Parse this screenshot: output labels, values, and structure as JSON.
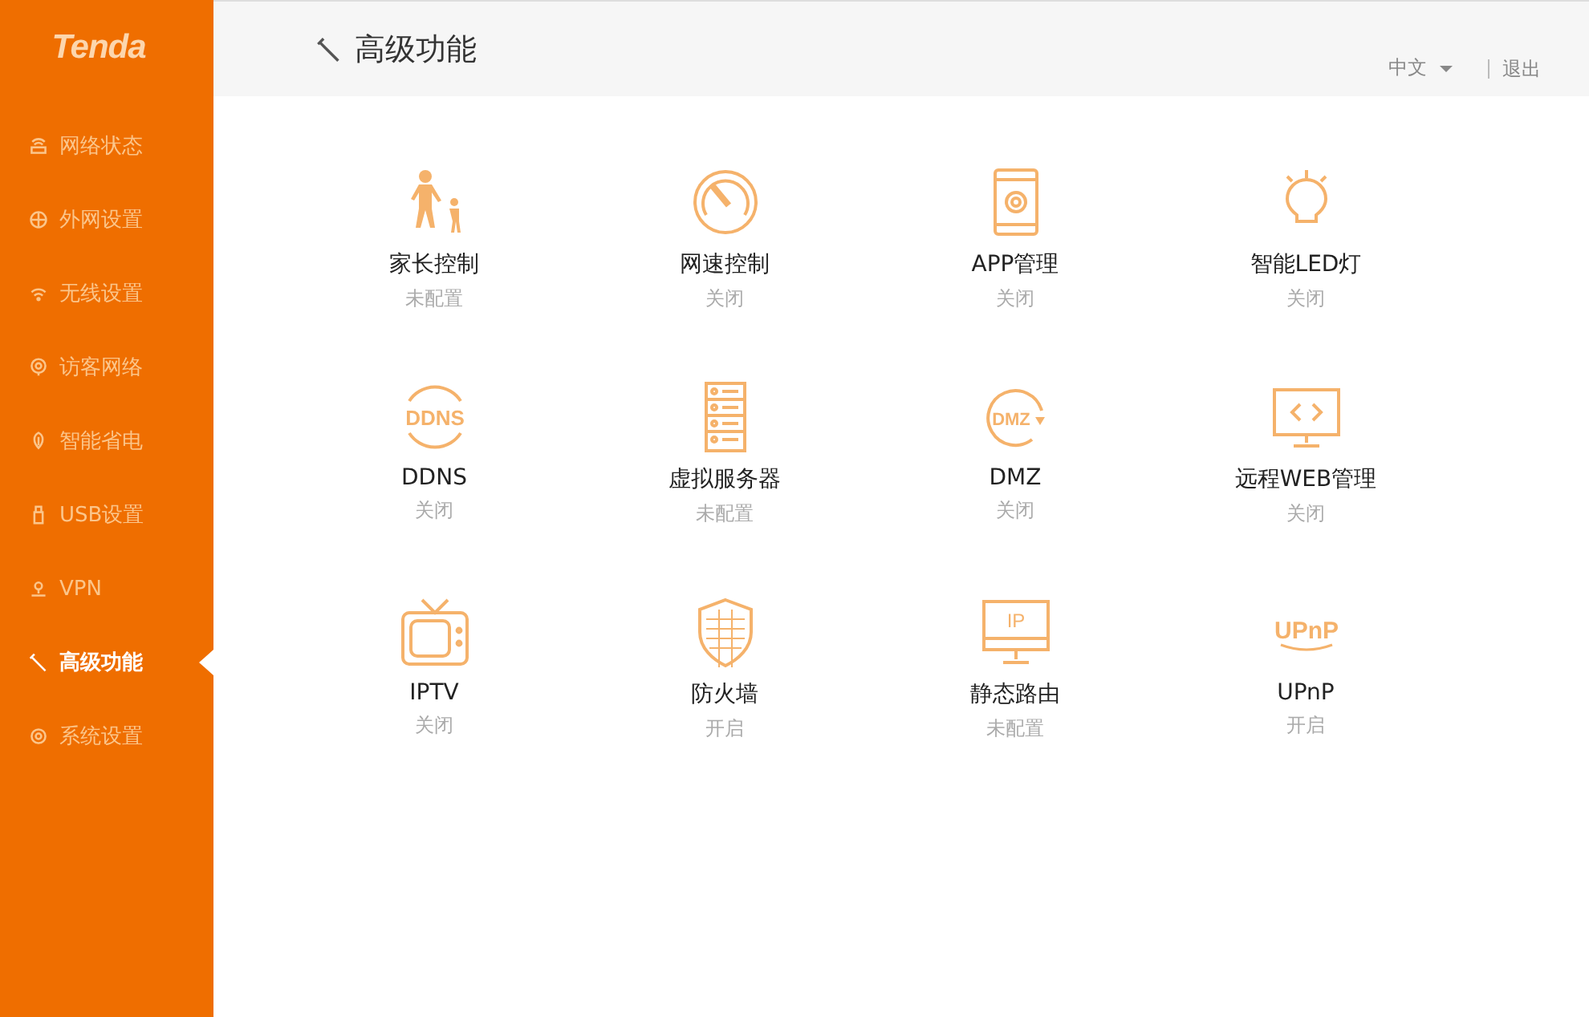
{
  "logo": "Tenda",
  "sidebar": {
    "items": [
      {
        "label": "网络状态",
        "selected": false
      },
      {
        "label": "外网设置",
        "selected": false
      },
      {
        "label": "无线设置",
        "selected": false
      },
      {
        "label": "访客网络",
        "selected": false
      },
      {
        "label": "智能省电",
        "selected": false
      },
      {
        "label": "USB设置",
        "selected": false
      },
      {
        "label": "VPN",
        "selected": false
      },
      {
        "label": "高级功能",
        "selected": true
      },
      {
        "label": "系统设置",
        "selected": false
      }
    ]
  },
  "header": {
    "title": "高级功能",
    "language": "中文",
    "logout": "退出"
  },
  "features": [
    {
      "name": "家长控制",
      "status": "未配置",
      "kind": "parent"
    },
    {
      "name": "网速控制",
      "status": "关闭",
      "kind": "speed"
    },
    {
      "name": "APP管理",
      "status": "关闭",
      "kind": "app"
    },
    {
      "name": "智能LED灯",
      "status": "关闭",
      "kind": "led"
    },
    {
      "name": "DDNS",
      "status": "关闭",
      "kind": "ddns",
      "icon_text": "DDNS"
    },
    {
      "name": "虚拟服务器",
      "status": "未配置",
      "kind": "server"
    },
    {
      "name": "DMZ",
      "status": "关闭",
      "kind": "dmz",
      "icon_text": "DMZ"
    },
    {
      "name": "远程WEB管理",
      "status": "关闭",
      "kind": "monitor"
    },
    {
      "name": "IPTV",
      "status": "关闭",
      "kind": "tv"
    },
    {
      "name": "防火墙",
      "status": "开启",
      "kind": "shield"
    },
    {
      "name": "静态路由",
      "status": "未配置",
      "kind": "ip",
      "icon_text": "IP"
    },
    {
      "name": "UPnP",
      "status": "开启",
      "kind": "upnp",
      "icon_text": "UPnP"
    }
  ]
}
